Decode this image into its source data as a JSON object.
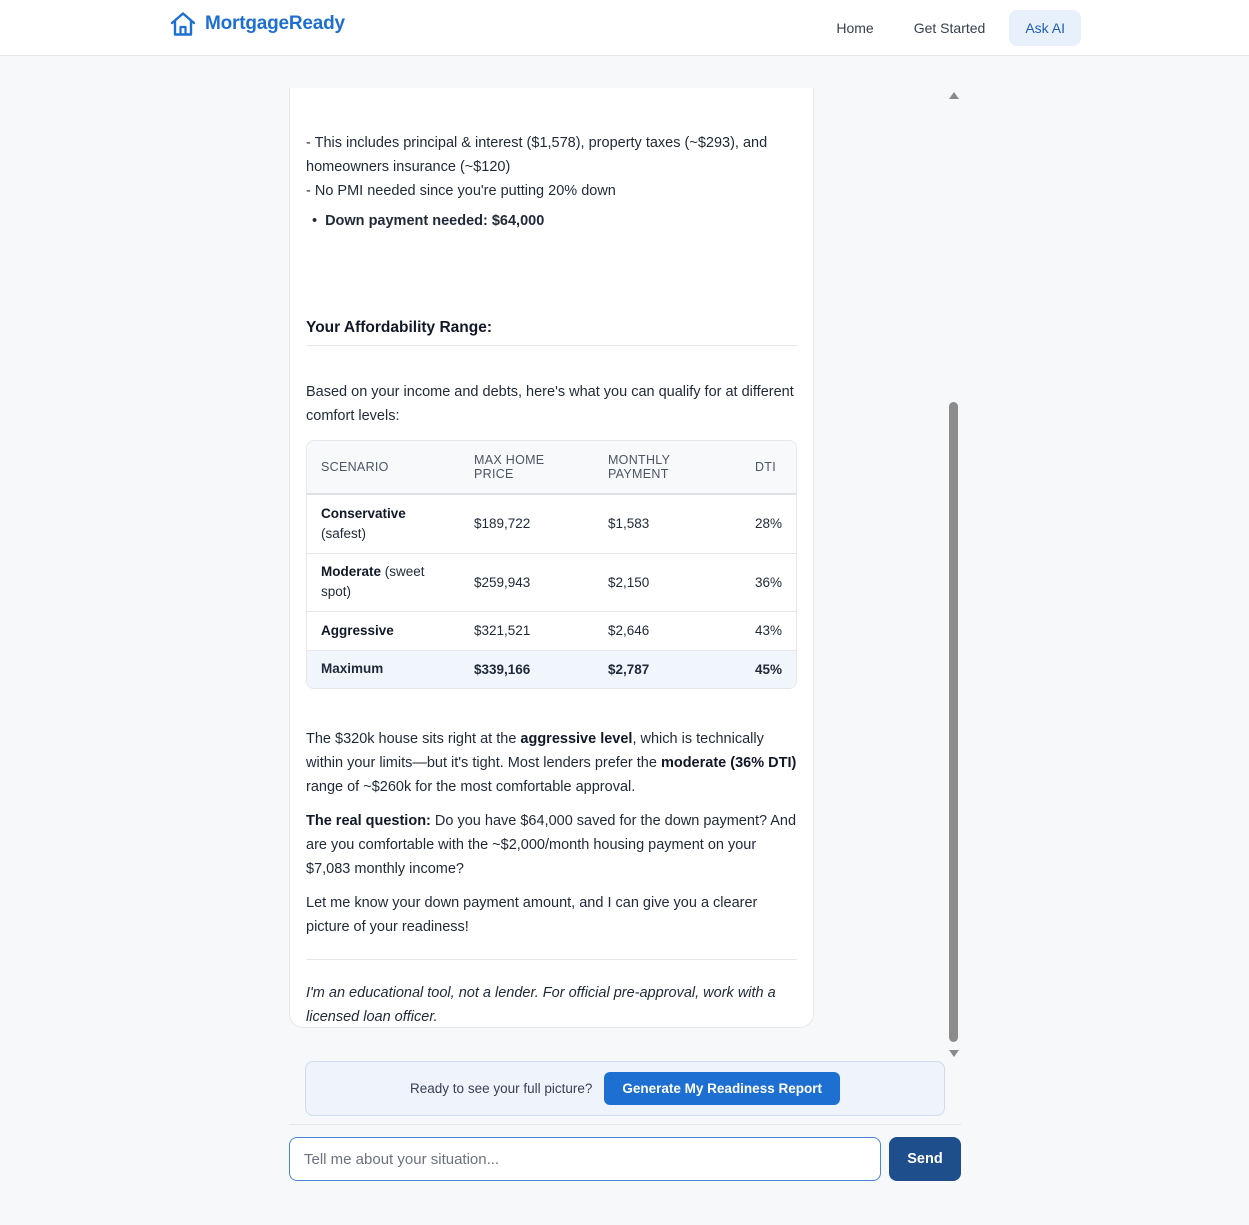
{
  "header": {
    "brand": "MortgageReady",
    "icon": "house-icon",
    "brand_color": "#1d6fd1",
    "nav": [
      {
        "label": "Home",
        "active": false
      },
      {
        "label": "Get Started",
        "active": false
      },
      {
        "label": "Ask AI",
        "active": true
      }
    ]
  },
  "message": {
    "payment_breakdown_1": "- This includes principal & interest ($1,578), property taxes (~$293), and homeowners insurance (~$120)",
    "payment_breakdown_2": "- No PMI needed since you're putting 20% down",
    "down_payment_bullet": "Down payment needed: $64,000",
    "range_heading": "Your Affordability Range:",
    "range_intro": "Based on your income and debts, here's what you can qualify for at different comfort levels:",
    "table": {
      "headers": [
        "SCENARIO",
        "MAX HOME PRICE",
        "MONTHLY PAYMENT",
        "DTI"
      ],
      "rows": [
        {
          "name": "Conservative",
          "note": "(safest)",
          "price": "$189,722",
          "payment": "$1,583",
          "dti": "28%"
        },
        {
          "name": "Moderate",
          "note": "(sweet spot)",
          "price": "$259,943",
          "payment": "$2,150",
          "dti": "36%"
        },
        {
          "name": "Aggressive",
          "note": "",
          "price": "$321,521",
          "payment": "$2,646",
          "dti": "43%"
        },
        {
          "name": "Maximum",
          "note": "",
          "price": "$339,166",
          "payment": "$2,787",
          "dti": "45%"
        }
      ]
    },
    "p1_a": "The $320k house sits right at the ",
    "p1_b": "aggressive level",
    "p1_c": ", which is technically within your limits—but it's tight. Most lenders prefer the ",
    "p1_d": "moderate (36% DTI)",
    "p1_e": " range of ~$260k for the most comfortable approval.",
    "p2_a": "The real question:",
    "p2_b": " Do you have $64,000 saved for the down payment? And are you comfortable with the ~$2,000/month housing payment on your $7,083 monthly income?",
    "p3": "Let me know your down payment amount, and I can give you a clearer picture of your readiness!",
    "disclaimer": "I'm an educational tool, not a lender. For official pre-approval, work with a licensed loan officer."
  },
  "cta": {
    "text": "Ready to see your full picture?",
    "button": "Generate My Readiness Report"
  },
  "composer": {
    "placeholder": "Tell me about your situation...",
    "value": "",
    "send": "Send"
  }
}
